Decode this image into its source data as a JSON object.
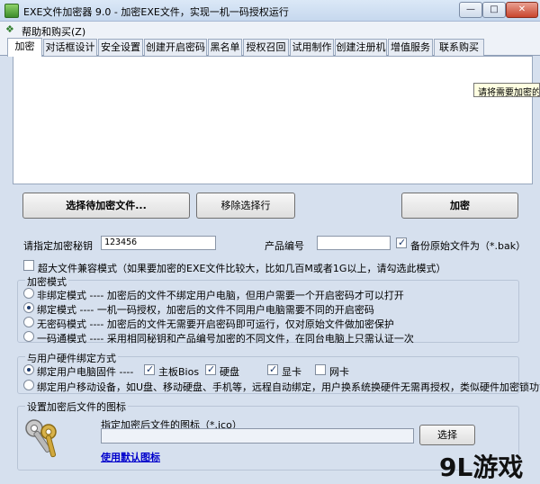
{
  "window": {
    "title": "EXE文件加密器 9.0 - 加密EXE文件，实现一机一码授权运行",
    "min_glyph": "—",
    "max_glyph": "□",
    "close_glyph": "✕"
  },
  "menu": {
    "label": "帮助和购买(Z)"
  },
  "tabs": [
    "加密",
    "对话框设计",
    "安全设置",
    "创建开启密码",
    "黑名单",
    "授权召回",
    "试用制作",
    "创建注册机",
    "增值服务",
    "联系购买"
  ],
  "tooltip": "请将需要加密的",
  "buttons": {
    "select_file": "选择待加密文件...",
    "remove_row": "移除选择行",
    "encrypt": "加密",
    "browse": "选择"
  },
  "key_row": {
    "key_label": "请指定加密秘钥",
    "key_value": "123456",
    "product_label": "产品编号",
    "product_value": "",
    "backup_label": "备份原始文件为（*.bak）",
    "backup_checked": true
  },
  "large_file": {
    "label": "超大文件兼容模式（如果要加密的EXE文件比较大，比如几百M或者1G以上，请勾选此模式）",
    "checked": false
  },
  "encrypt_mode": {
    "legend": "加密模式",
    "options": [
      {
        "label": "非绑定模式 ---- 加密后的文件不绑定用户电脑，但用户需要一个开启密码才可以打开",
        "checked": false
      },
      {
        "label": "绑定模式 ---- 一机一码授权，加密后的文件不同用户电脑需要不同的开启密码",
        "checked": true
      },
      {
        "label": "无密码模式 ---- 加密后的文件无需要开启密码即可运行，仅对原始文件做加密保护",
        "checked": false
      },
      {
        "label": "一码通模式 ---- 采用相同秘钥和产品编号加密的不同文件，在同台电脑上只需认证一次",
        "checked": false
      }
    ]
  },
  "hardware": {
    "legend": "与用户硬件绑定方式",
    "pc_label": "绑定用户电脑固件 ----",
    "pc_checked": true,
    "items": [
      {
        "label": "主板Bios",
        "checked": true
      },
      {
        "label": "硬盘",
        "checked": true
      },
      {
        "label": "显卡",
        "checked": true
      },
      {
        "label": "网卡",
        "checked": false
      }
    ],
    "mobile_label": "绑定用户移动设备，如U盘、移动硬盘、手机等，远程自动绑定，用户换系统换硬件无需再授权，类似硬件加密锁功能",
    "mobile_checked": false
  },
  "icon_group": {
    "legend": "设置加密后文件的图标",
    "ico_label": "指定加密后文件的图标（*.ico）",
    "ico_path": "",
    "default_link": "使用默认图标"
  },
  "watermark": "9L游戏"
}
